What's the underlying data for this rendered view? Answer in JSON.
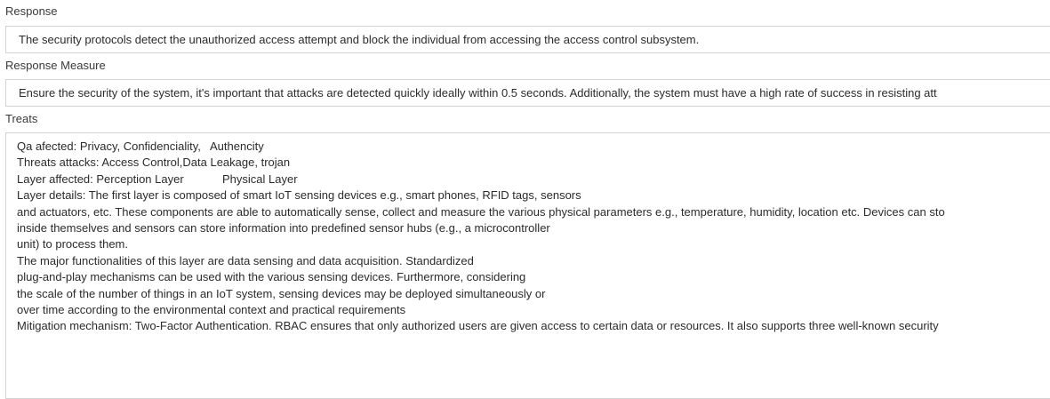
{
  "fields": {
    "response": {
      "label": "Response",
      "value": "The security protocols detect the unauthorized access attempt and block the individual from accessing the access control subsystem."
    },
    "response_measure": {
      "label": "Response Measure",
      "value": "Ensure the security of the system, it's important that attacks are detected quickly ideally within 0.5 seconds. Additionally, the system must have a high rate of success in resisting att"
    },
    "treats": {
      "label": "Treats",
      "lines": [
        "Qa afected: Privacy, Confidenciality,   Authencity",
        "Threats attacks: Access Control,Data Leakage, trojan",
        "Layer affected: Perception Layer            Physical Layer",
        "Layer details: The first layer is composed of smart IoT sensing devices e.g., smart phones, RFID tags, sensors",
        "and actuators, etc. These components are able to automatically sense, collect and measure the various physical parameters e.g., temperature, humidity, location etc. Devices can sto",
        "inside themselves and sensors can store information into predefined sensor hubs (e.g., a microcontroller",
        "unit) to process them.",
        "The major functionalities of this layer are data sensing and data acquisition. Standardized",
        "plug-and-play mechanisms can be used with the various sensing devices. Furthermore, considering",
        "the scale of the number of things in an IoT system, sensing devices may be deployed simultaneously or",
        "over time according to the environmental context and practical requirements",
        "Mitigation mechanism: Two-Factor Authentication. RBAC ensures that only authorized users are given access to certain data or resources. It also supports three well-known security"
      ]
    }
  }
}
